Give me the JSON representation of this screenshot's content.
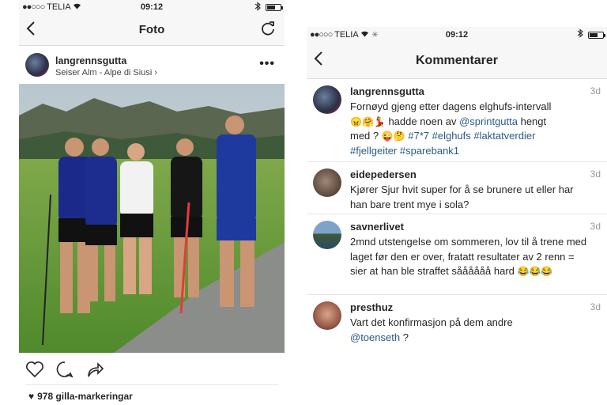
{
  "left_screen": {
    "status": {
      "carrier": "TELIA",
      "signal_dots": "●●○○○",
      "time": "09:12"
    },
    "nav": {
      "title": "Foto",
      "back_icon": "chevron-left-icon",
      "refresh_icon": "refresh-icon"
    },
    "post": {
      "username": "langrennsgutta",
      "location": "Seiser Alm - Alpe di Siusi",
      "location_chevron": "›",
      "more_label": "•••",
      "likes_text": "978 gilla-markeringar"
    }
  },
  "right_screen": {
    "status": {
      "carrier": "TELIA",
      "signal_dots": "●●○○○",
      "time": "09:12"
    },
    "nav": {
      "title": "Kommentarer",
      "back_icon": "chevron-left-icon"
    },
    "comments": [
      {
        "username": "langrennsgutta",
        "time": "3d",
        "line1": "Fornøyd gjeng etter dagens elghufs-intervall",
        "line2_emoji": "😠🤗💃",
        "line2_text": " hadde noen av ",
        "line2_mention": "@sprintgutta",
        "line2_tail": " hengt",
        "line3_text": "med ? ",
        "line3_emoji": "😜🤔",
        "line3_tags": " #7*7 #elghufs #laktatverdier",
        "line4_tags": "#fjellgeiter #sparebank1"
      },
      {
        "username": "eidepedersen",
        "time": "3d",
        "text": "Kjører Sjur hvit super for å se brunere ut eller har han bare trent mye i sola?"
      },
      {
        "username": "savnerlivet",
        "time": "3d",
        "text": "2mnd utstengelse om sommeren, lov til å trene med laget før den er over, fratatt resultater av 2 renn = sier at han ble straffet såååååå hard",
        "emoji": "😂😂😂"
      },
      {
        "username": "presthuz",
        "time": "3d",
        "text": "Vart det konfirmasjon på dem andre",
        "mention": "@toenseth",
        "tail": " ?"
      }
    ]
  },
  "colors": {
    "link": "#2b5a83",
    "text": "#262626",
    "muted": "#999999",
    "bar": "#f7f7f7"
  }
}
